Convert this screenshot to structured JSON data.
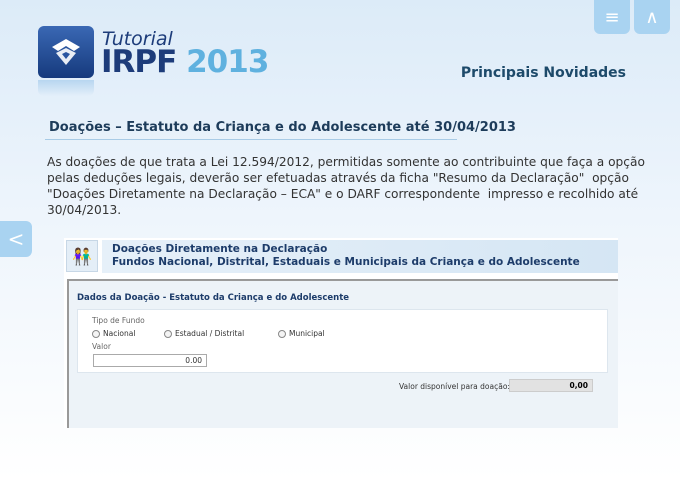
{
  "nav": {
    "menu_icon": "≡",
    "up_icon": "∧",
    "back_icon": "<"
  },
  "brand": {
    "tutorial": "Tutorial",
    "irpf": "IRPF",
    "year": "2013"
  },
  "header": {
    "section": "Principais Novidades"
  },
  "content": {
    "title": "Doações – Estatuto da Criança e do Adolescente até 30/04/2013",
    "lines": [
      "As doações de que trata a Lei 12.594/2012, permitidas somente ao contribuinte que faça a opção",
      "pelas deduções legais, deverão ser efetuadas através da ficha \"Resumo da Declaração\"  opção",
      "\"Doações Diretamente na Declaração – ECA\" e o DARF correspondente  impresso e recolhido até",
      "30/04/2013."
    ]
  },
  "screenshot": {
    "header_line1": "Doações Diretamente na Declaração",
    "header_line2": "Fundos Nacional, Distrital, Estaduais e Municipais da Criança e do Adolescente",
    "panel_title": "Dados da Doação - Estatuto da Criança e do Adolescente",
    "tipo_label": "Tipo de Fundo",
    "options": [
      "Nacional",
      "Estadual / Distrital",
      "Municipal"
    ],
    "valor_label": "Valor",
    "valor": "0.00",
    "disp_label": "Valor disponível para doação:",
    "disp_value": "0,00"
  }
}
